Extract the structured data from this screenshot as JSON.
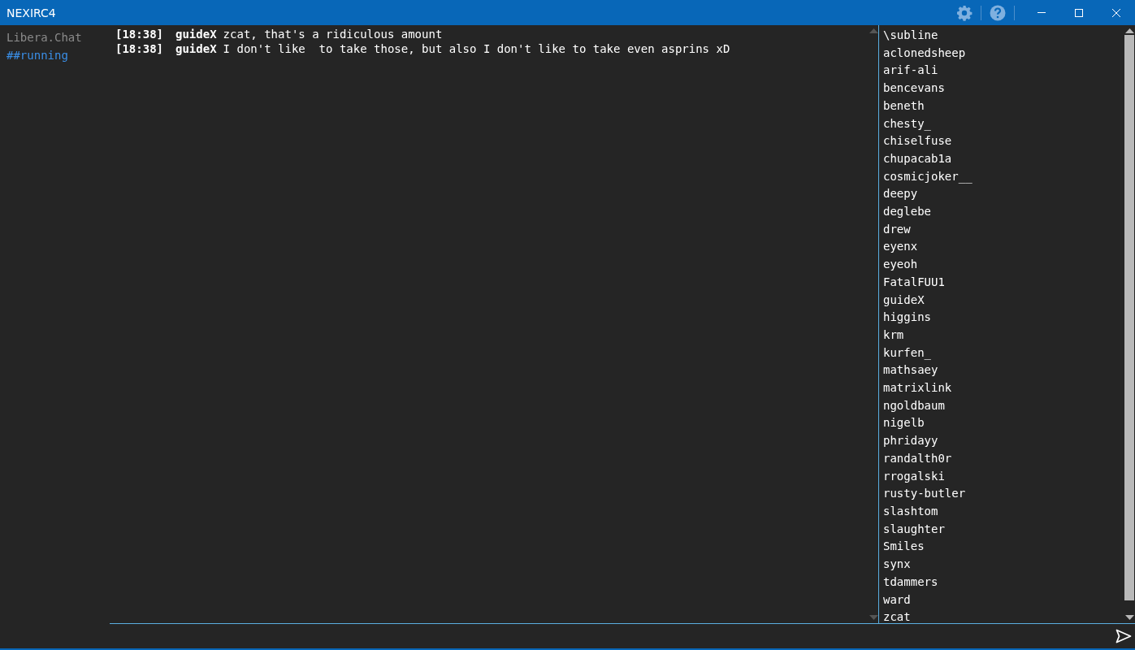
{
  "window": {
    "title": "NEXIRC4"
  },
  "sidebar": {
    "items": [
      {
        "label": "Libera.Chat",
        "selected": false
      },
      {
        "label": "##running",
        "selected": true
      }
    ]
  },
  "messages": [
    {
      "time": "[18:38]",
      "nick": "guideX",
      "text": "zcat, that's a ridiculous amount"
    },
    {
      "time": "[18:38]",
      "nick": "guideX",
      "text": "I don't like  to take those, but also I don't like to take even asprins xD"
    }
  ],
  "nicklist": [
    "\\subline",
    "aclonedsheep",
    "arif-ali",
    "bencevans",
    "beneth",
    "chesty_",
    "chiselfuse",
    "chupacab1a",
    "cosmicjoker__",
    "deepy",
    "deglebe",
    "drew",
    "eyenx",
    "eyeoh",
    "FatalFUU1",
    "guideX",
    "higgins",
    "krm",
    "kurfen_",
    "mathsaey",
    "matrixlink",
    "ngoldbaum",
    "nigelb",
    "phridayy",
    "randalth0r",
    "rrogalski",
    "rusty-butler",
    "slashtom",
    "slaughter",
    "Smiles",
    "synx",
    "tdammers",
    "ward",
    "zcat"
  ]
}
